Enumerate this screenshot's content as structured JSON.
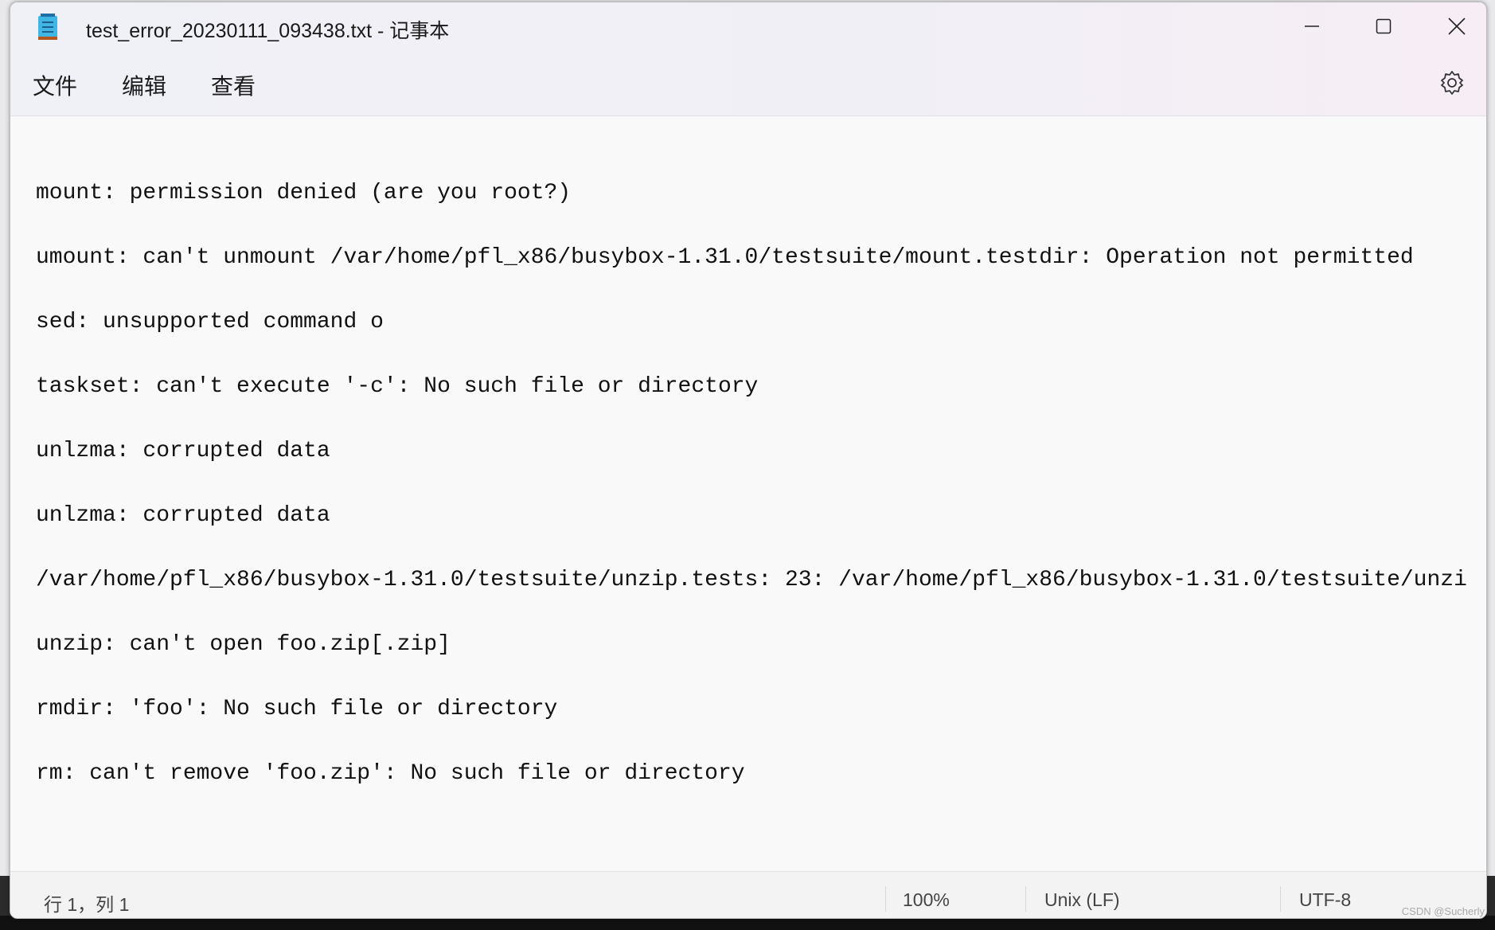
{
  "window": {
    "title": "test_error_20230111_093438.txt - 记事本",
    "app_icon": "notepad-icon",
    "controls": [
      "minimize-icon",
      "maximize-icon",
      "close-icon"
    ]
  },
  "menu": {
    "items": [
      {
        "label": "文件"
      },
      {
        "label": "编辑"
      },
      {
        "label": "查看"
      }
    ],
    "settings_icon": "gear-icon"
  },
  "editor": {
    "lines": [
      "mount: permission denied (are you root?)",
      "umount: can't unmount /var/home/pfl_x86/busybox-1.31.0/testsuite/mount.testdir: Operation not permitted",
      "sed: unsupported command o",
      "taskset: can't execute '-c': No such file or directory",
      "unlzma: corrupted data",
      "unlzma: corrupted data",
      "/var/home/pfl_x86/busybox-1.31.0/testsuite/unzip.tests: 23: /var/home/pfl_x86/busybox-1.31.0/testsuite/unzi",
      "unzip: can't open foo.zip[.zip]",
      "rmdir: 'foo': No such file or directory",
      "rm: can't remove 'foo.zip': No such file or directory"
    ]
  },
  "status": {
    "position": "行 1，列 1",
    "zoom": "100%",
    "line_ending": "Unix (LF)",
    "encoding": "UTF-8"
  },
  "watermark": "CSDN @Sucherly"
}
